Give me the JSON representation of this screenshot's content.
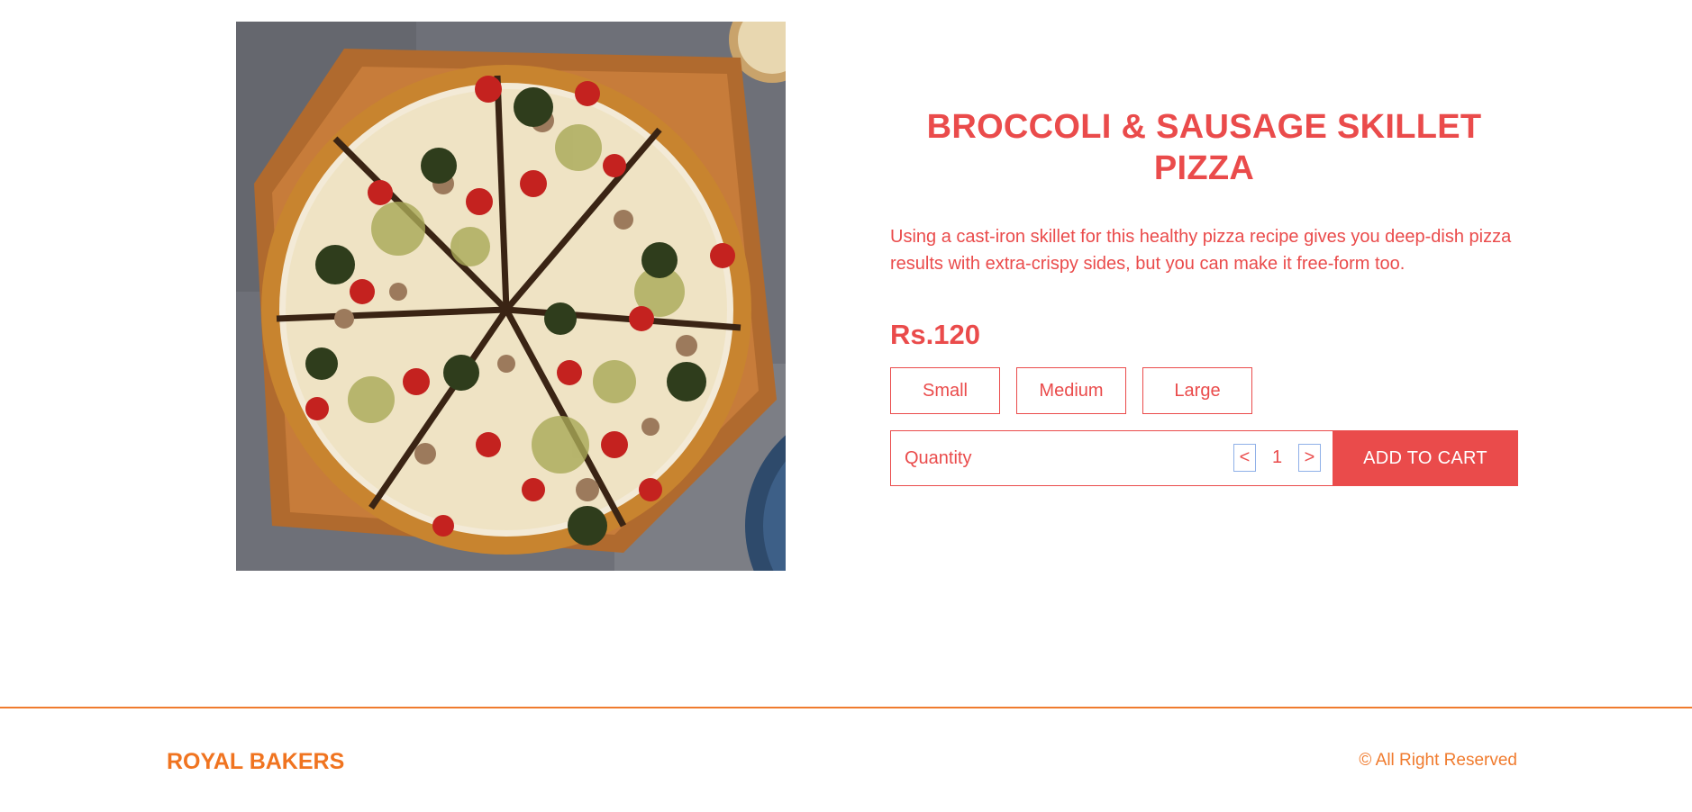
{
  "product": {
    "image_alt": "Broccoli & Sausage Skillet Pizza",
    "title": "BROCCOLI & SAUSAGE SKILLET PIZZA",
    "description": "Using a cast-iron skillet for this healthy pizza recipe gives you deep-dish pizza results with extra-crispy sides, but you can make it free-form too.",
    "price": "Rs.120",
    "sizes": [
      {
        "label": "Small"
      },
      {
        "label": "Medium"
      },
      {
        "label": "Large"
      }
    ]
  },
  "cart": {
    "quantity_label": "Quantity",
    "decrement_label": "<",
    "quantity_value": "1",
    "increment_label": ">",
    "add_to_cart_label": "ADD TO CART"
  },
  "footer": {
    "brand": "ROYAL BAKERS",
    "copyright": "© All Right Reserved"
  },
  "colors": {
    "accent": "#ea4b4b",
    "footer_accent": "#f07b2e",
    "stepper_border": "#8fb0e8"
  }
}
